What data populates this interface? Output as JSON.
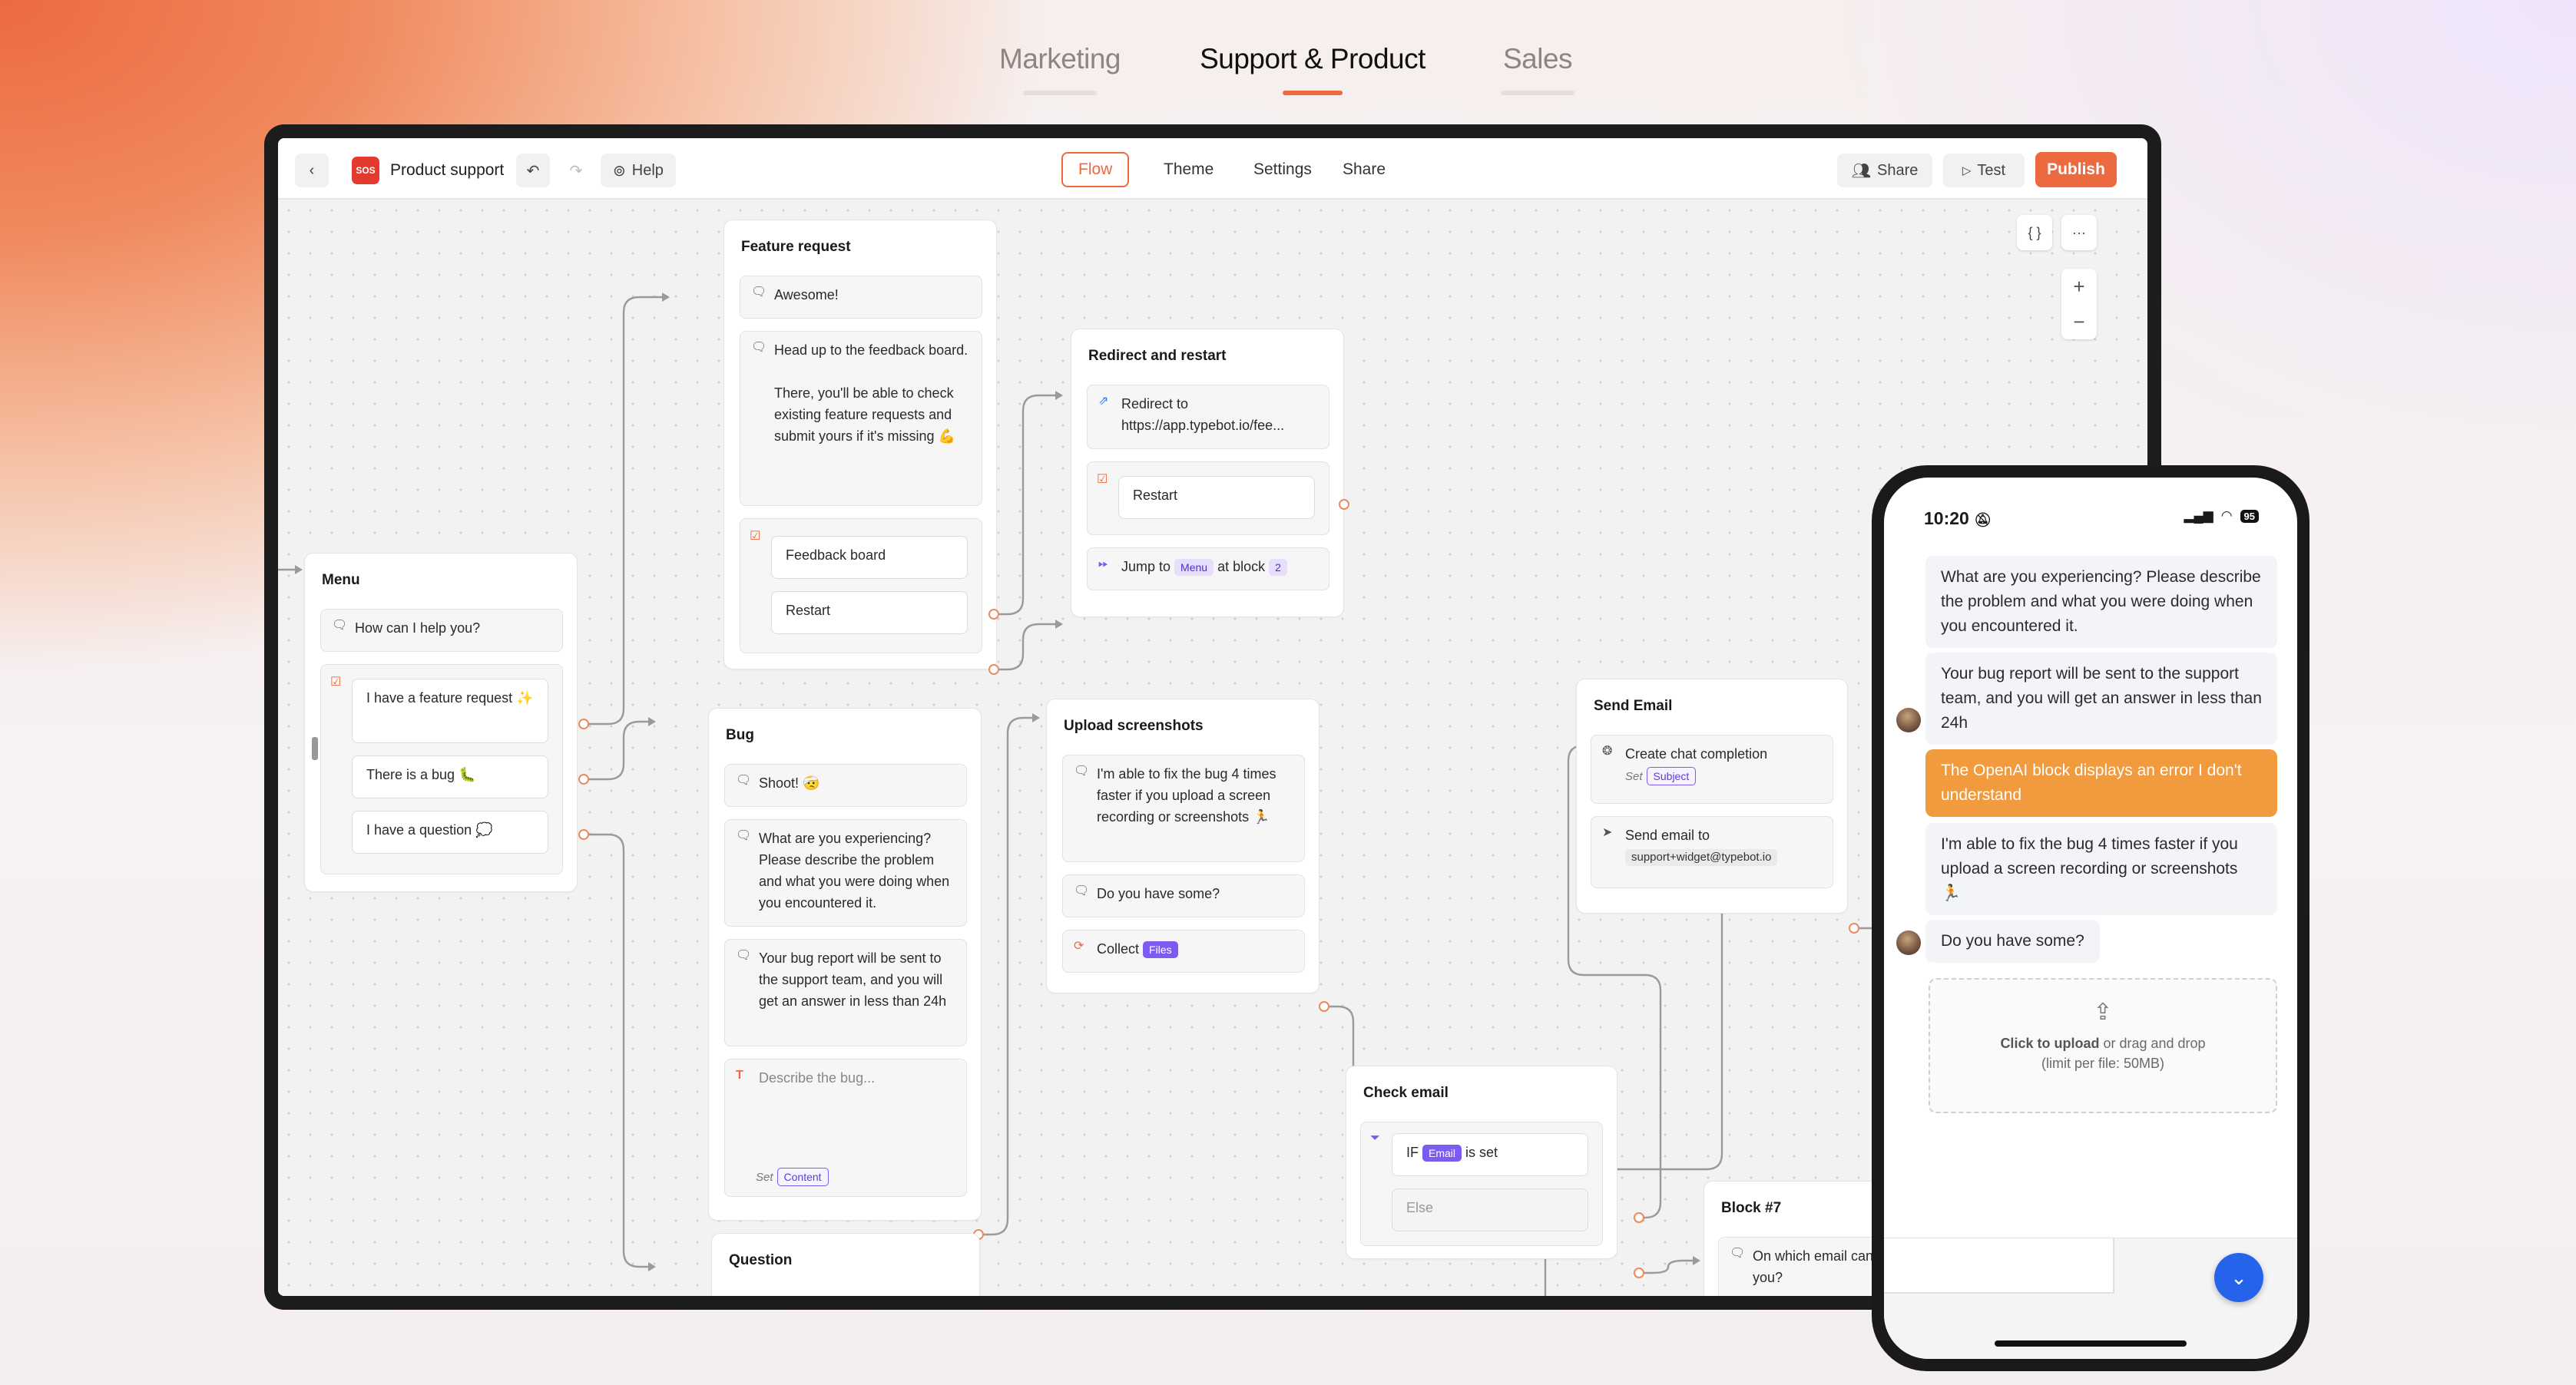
{
  "tabs": [
    {
      "label": "Marketing"
    },
    {
      "label": "Support & Product"
    },
    {
      "label": "Sales"
    }
  ],
  "editor": {
    "logo_text": "SOS",
    "title": "Product support",
    "help_label": "Help",
    "nav_tabs": [
      "Flow",
      "Theme",
      "Settings",
      "Share"
    ],
    "share_label": "Share",
    "test_label": "Test",
    "publish_label": "Publish",
    "json_button": "{ }",
    "more_button": "···"
  },
  "blocks": {
    "menu": {
      "title": "Menu",
      "text": "How can I help you?",
      "choices": [
        "I have a feature request ✨",
        "There is a bug 🐛",
        "I have a question 💭"
      ]
    },
    "feature": {
      "title": "Feature request",
      "text1": "Awesome!",
      "text2_a": "Head up to the feedback board.",
      "text2_b": "There, you'll be able to check existing feature requests and submit yours if it's missing 💪",
      "choices": [
        "Feedback board",
        "Restart"
      ]
    },
    "redirect": {
      "title": "Redirect and restart",
      "redirect_label": "Redirect to",
      "redirect_url": "https://app.typebot.io/fee...",
      "restart": "Restart",
      "jump_pre": "Jump to",
      "jump_tag": "Menu",
      "jump_mid": "at block",
      "jump_num": "2"
    },
    "bug": {
      "title": "Bug",
      "text1": "Shoot! 🤕",
      "text2": "What are you experiencing? Please describe the problem and what you were doing when you encountered it.",
      "text3": "Your bug report will be sent to the support team, and you will get an answer in less than 24h",
      "input_placeholder": "Describe the bug...",
      "set_label": "Set",
      "set_tag": "Content"
    },
    "upload": {
      "title": "Upload screenshots",
      "text1": "I'm able to fix the bug 4 times faster if you upload a screen recording or screenshots 🏃",
      "text2": "Do you have some?",
      "collect": "Collect",
      "collect_tag": "Files"
    },
    "send_email": {
      "title": "Send Email",
      "step1": "Create chat completion",
      "set_label": "Set",
      "set_tag": "Subject",
      "step2": "Send email to",
      "email": "support+widget@typebot.io"
    },
    "check_email": {
      "title": "Check email",
      "if": "IF",
      "tag": "Email",
      "is_set": "is set",
      "else": "Else"
    },
    "block7": {
      "title": "Block #7",
      "text": "On which email can I contact you?"
    },
    "question": {
      "title": "Question"
    },
    "partial": {
      "title": "B"
    }
  },
  "phone": {
    "time": "10:20",
    "battery": "95",
    "msg1": "What are you experiencing? Please describe the problem and what you were doing when you encountered it.",
    "msg2": "Your bug report will be sent to the support team, and you will get an answer in less than 24h",
    "user_msg": "The OpenAI block displays an error I don't understand",
    "msg3": "I'm able to fix the bug 4 times faster if you upload a screen recording or screenshots 🏃",
    "msg4": "Do you have some?",
    "upload_bold": "Click to upload",
    "upload_rest": "or drag and drop",
    "upload_limit": "(limit per file: 50MB)"
  },
  "colors": {
    "accent": "#ec6a3f",
    "tag_purple": "#7c5cf0",
    "user_bubble": "#f19a3e",
    "fab": "#2563eb"
  }
}
